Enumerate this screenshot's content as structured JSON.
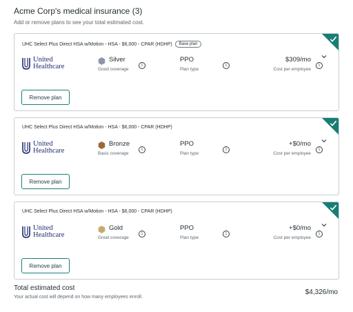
{
  "header": {
    "title": "Acme Corp's medical insurance (3)",
    "subtitle": "Add or remove plans to see your total estimated cost."
  },
  "plans": [
    {
      "name": "UHC Select Plus Direct HSA w/Motion - HSA - $6,000 - CPAR (HDHP)",
      "badge": "Base plan",
      "carrier_line1": "United",
      "carrier_line2": "Healthcare",
      "tier": "Silver",
      "tier_desc": "Good coverage",
      "tier_color": "#8a97a8",
      "plan_type": "PPO",
      "plan_type_label": "Plan type",
      "cost": "$309/mo",
      "cost_label": "Cost per employee",
      "remove_label": "Remove plan"
    },
    {
      "name": "UHC Select Plus Direct HSA w/Motion - HSA - $6,000 - CPAR (HDHP)",
      "badge": "",
      "carrier_line1": "United",
      "carrier_line2": "Healthcare",
      "tier": "Bronze",
      "tier_desc": "Basic coverage",
      "tier_color": "#9a6a3c",
      "plan_type": "PPO",
      "plan_type_label": "Plan type",
      "cost": "+$0/mo",
      "cost_label": "Cost per employee",
      "remove_label": "Remove plan"
    },
    {
      "name": "UHC Select Plus Direct HSA w/Motion - HSA - $6,000 - CPAR (HDHP)",
      "badge": "",
      "carrier_line1": "United",
      "carrier_line2": "Healthcare",
      "tier": "Gold",
      "tier_desc": "Great coverage",
      "tier_color": "#c9a96a",
      "plan_type": "PPO",
      "plan_type_label": "Plan type",
      "cost": "+$0/mo",
      "cost_label": "Cost per employee",
      "remove_label": "Remove plan"
    }
  ],
  "total": {
    "title": "Total estimated cost",
    "subtitle": "Your actual cost will depend on how many employees enroll.",
    "value": "$4,326/mo"
  },
  "colors": {
    "accent": "#177e73",
    "uhc_blue": "#1e2b70"
  }
}
